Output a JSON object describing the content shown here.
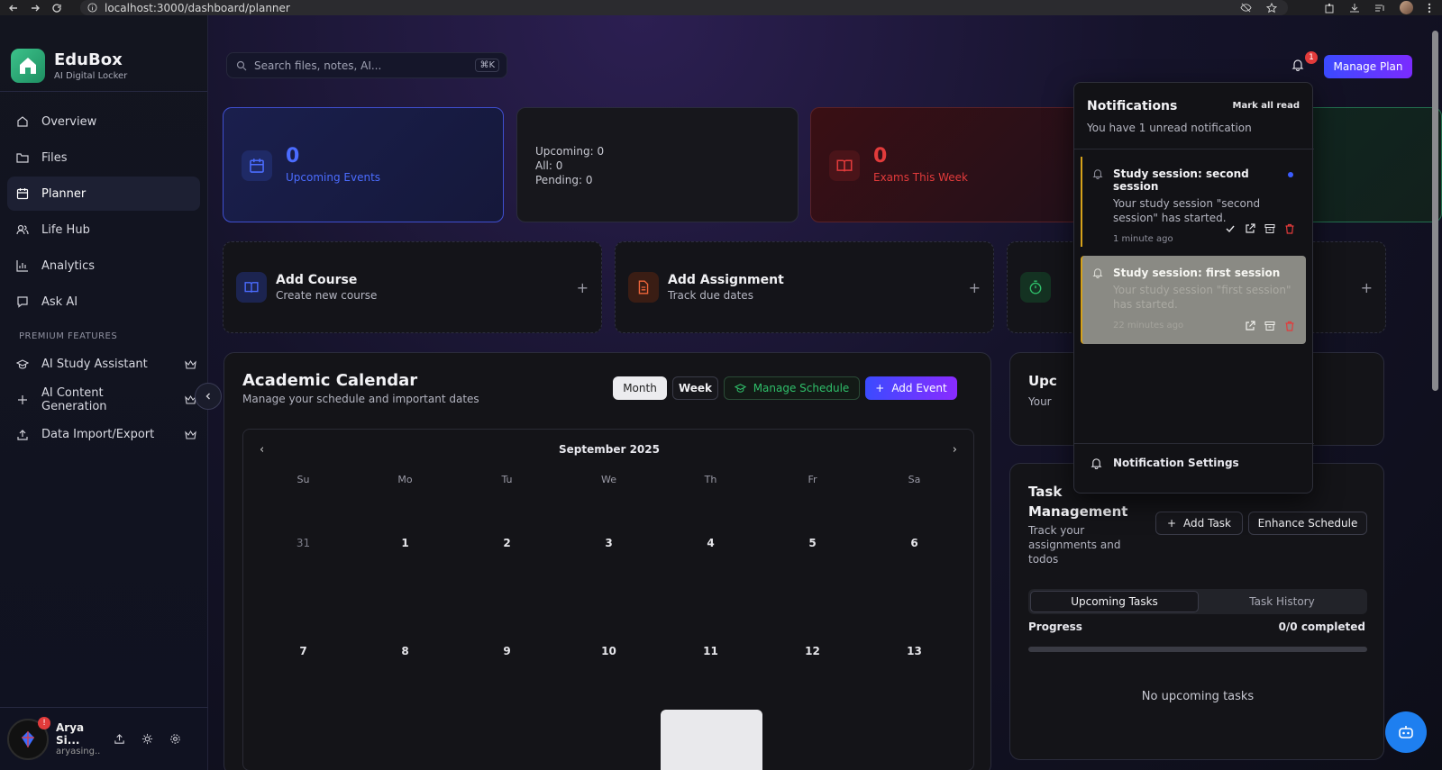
{
  "browser": {
    "url": "localhost:3000/dashboard/planner"
  },
  "brand": {
    "title": "EduBox",
    "subtitle": "AI Digital Locker"
  },
  "sidebar": {
    "items": [
      {
        "label": "Overview",
        "icon": "home-icon"
      },
      {
        "label": "Files",
        "icon": "folder-icon"
      },
      {
        "label": "Planner",
        "icon": "calendar-icon",
        "active": true
      },
      {
        "label": "Life Hub",
        "icon": "users-icon"
      },
      {
        "label": "Analytics",
        "icon": "chart-icon"
      },
      {
        "label": "Ask AI",
        "icon": "chat-icon"
      }
    ],
    "premium_label": "PREMIUM FEATURES",
    "premium": [
      {
        "label": "AI Study Assistant",
        "icon": "graduation-cap-icon"
      },
      {
        "label": "AI Content Generation",
        "icon": "plus-icon"
      },
      {
        "label": "Data Import/Export",
        "icon": "upload-icon"
      }
    ]
  },
  "user": {
    "name": "Arya Si...",
    "email": "aryasing...",
    "badge": "!"
  },
  "search": {
    "placeholder": "Search files, notes, AI...",
    "shortcut": "⌘K"
  },
  "header": {
    "notif_count": "1",
    "manage_plan": "Manage Plan"
  },
  "stats": {
    "upcoming": {
      "value": "0",
      "label": "Upcoming Events"
    },
    "summary": {
      "line1": "Upcoming: 0",
      "line2": "All: 0",
      "line3": "Pending: 0"
    },
    "exams": {
      "value": "0",
      "label": "Exams This Week"
    }
  },
  "quick_actions": [
    {
      "title": "Add Course",
      "sub": "Create new course"
    },
    {
      "title": "Add Assignment",
      "sub": "Track due dates"
    }
  ],
  "calendar": {
    "title": "Academic Calendar",
    "subtitle": "Manage your schedule and important dates",
    "btn_month": "Month",
    "btn_week": "Week",
    "btn_manage": "Manage Schedule",
    "btn_add": "Add Event",
    "month": "September 2025",
    "dow": [
      "Su",
      "Mo",
      "Tu",
      "We",
      "Th",
      "Fr",
      "Sa"
    ],
    "week1": [
      "31",
      "1",
      "2",
      "3",
      "4",
      "5",
      "6"
    ],
    "week2": [
      "7",
      "8",
      "9",
      "10",
      "11",
      "12",
      "13"
    ]
  },
  "upcoming_card": {
    "title": "Upc",
    "sub": "Your"
  },
  "tasks": {
    "title": "Task Management",
    "subtitle": "Track your assignments and todos",
    "add": "Add Task",
    "enhance": "Enhance Schedule",
    "tab_upcoming": "Upcoming Tasks",
    "tab_history": "Task History",
    "progress_label": "Progress",
    "progress_count": "0/0 completed",
    "progress": 0,
    "empty": "No upcoming tasks"
  },
  "notifications": {
    "title": "Notifications",
    "mark_all": "Mark all read",
    "subtitle": "You have 1 unread notification",
    "items": [
      {
        "title": "Study session: second session",
        "body": "Your study session \"second session\" has started.",
        "time": "1 minute ago",
        "unread": true
      },
      {
        "title": "Study session: first session",
        "body": "Your study session \"first session\" has started.",
        "time": "22 minutes ago",
        "unread": false
      }
    ],
    "settings": "Notification Settings"
  },
  "colors": {
    "accent": "#3b4bff",
    "brand": "#3cc28a",
    "danger": "#e23b3b",
    "highlight": "#d6a21a"
  }
}
